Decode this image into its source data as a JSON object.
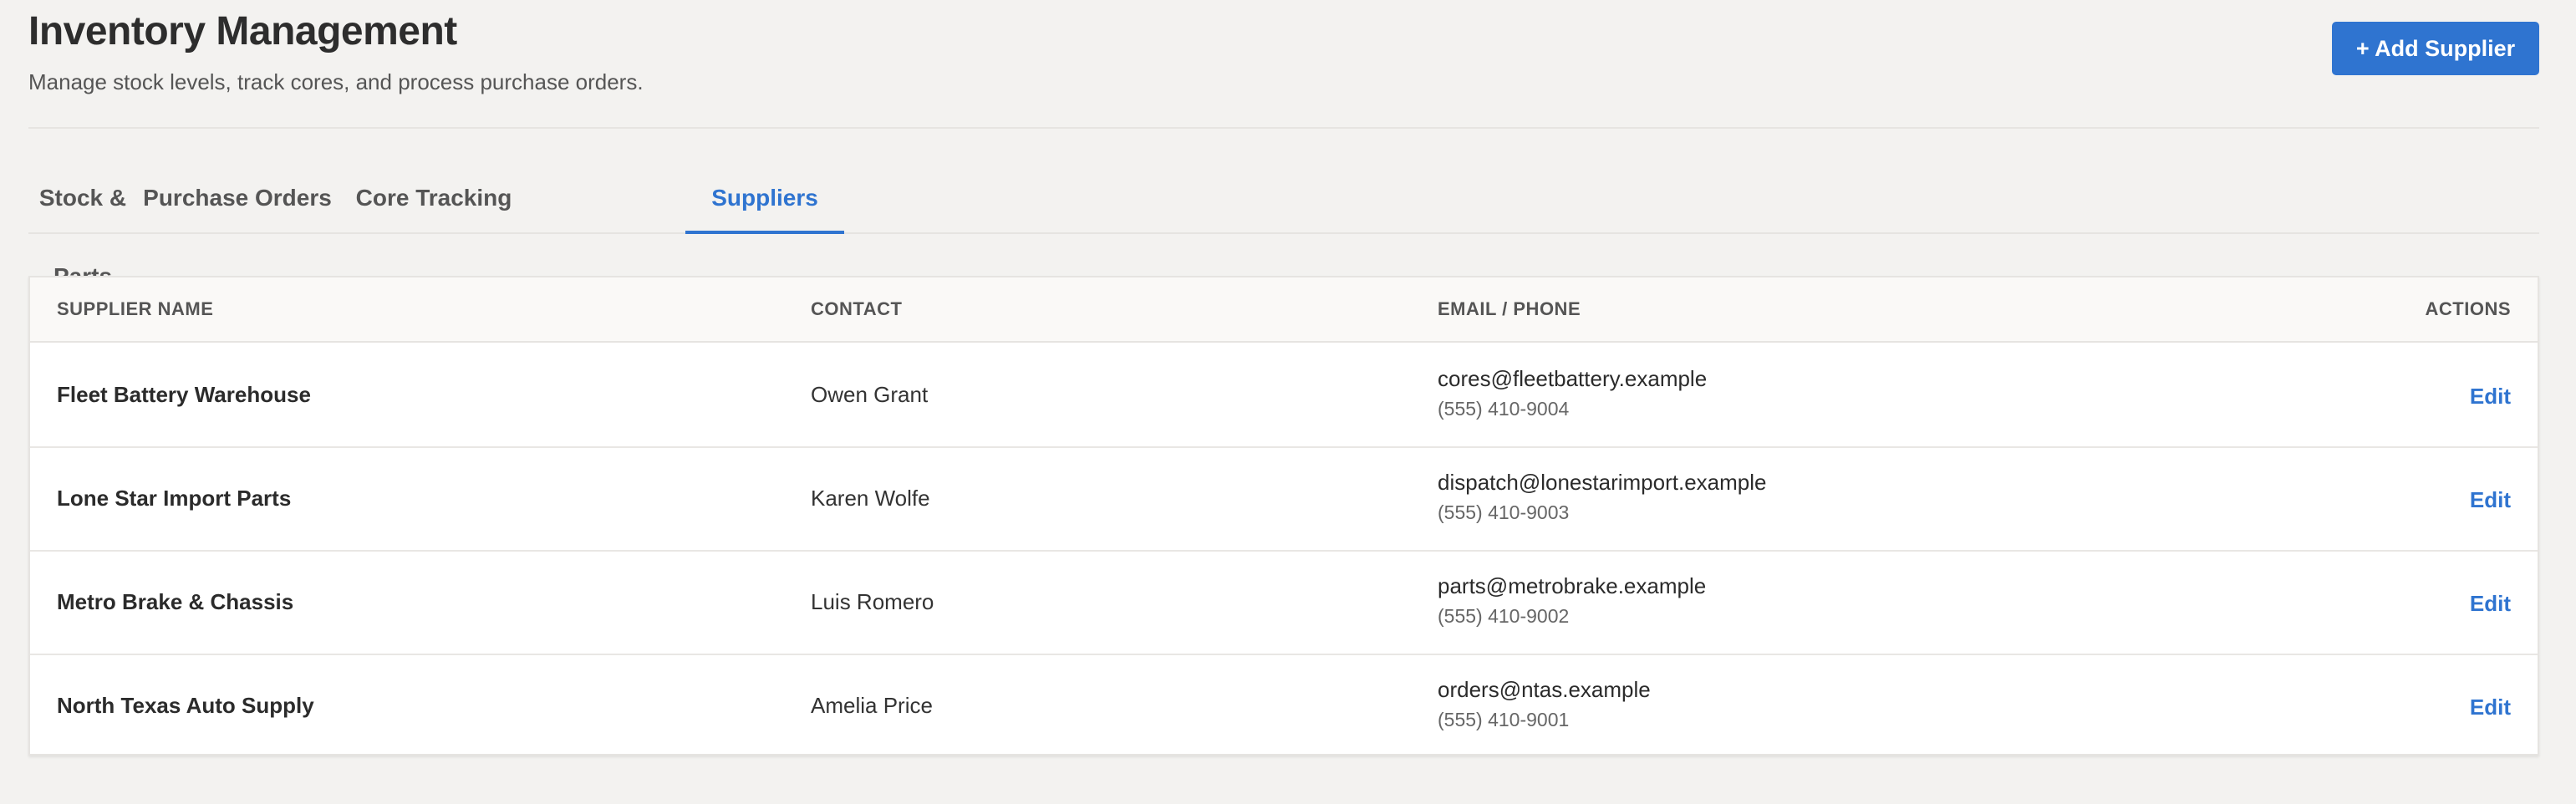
{
  "header": {
    "title": "Inventory Management",
    "subtitle": "Manage stock levels, track cores, and process purchase orders.",
    "add_supplier_label": "+ Add Supplier"
  },
  "tabs": [
    {
      "label": "Stock & Parts",
      "active": false
    },
    {
      "label": "Purchase Orders",
      "active": false
    },
    {
      "label": "Core Tracking",
      "active": false
    },
    {
      "label": "Suppliers",
      "active": true
    }
  ],
  "table": {
    "columns": {
      "name": "SUPPLIER NAME",
      "contact": "CONTACT",
      "email_phone": "EMAIL / PHONE",
      "actions": "ACTIONS"
    },
    "rows": [
      {
        "name": "Fleet Battery Warehouse",
        "contact": "Owen Grant",
        "email": "cores@fleetbattery.example",
        "phone": "(555) 410-9004",
        "action": "Edit"
      },
      {
        "name": "Lone Star Import Parts",
        "contact": "Karen Wolfe",
        "email": "dispatch@lonestarimport.example",
        "phone": "(555) 410-9003",
        "action": "Edit"
      },
      {
        "name": "Metro Brake & Chassis",
        "contact": "Luis Romero",
        "email": "parts@metrobrake.example",
        "phone": "(555) 410-9002",
        "action": "Edit"
      },
      {
        "name": "North Texas Auto Supply",
        "contact": "Amelia Price",
        "email": "orders@ntas.example",
        "phone": "(555) 410-9001",
        "action": "Edit"
      }
    ]
  },
  "colors": {
    "accent": "#2f74d0",
    "background": "#f3f2f0",
    "card": "#ffffff"
  }
}
